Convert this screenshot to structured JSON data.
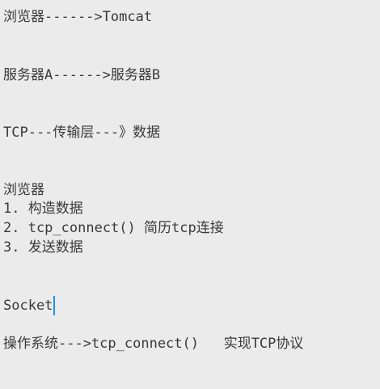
{
  "document": {
    "lines": [
      "浏览器------>Tomcat",
      "服务器A------>服务器B",
      "TCP---传输层---》数据",
      "浏览器",
      "1. 构造数据",
      "2. tcp_connect() 简历tcp连接",
      "3. 发送数据",
      "Socket",
      "操作系统--->tcp_connect()   实现TCP协议"
    ]
  }
}
